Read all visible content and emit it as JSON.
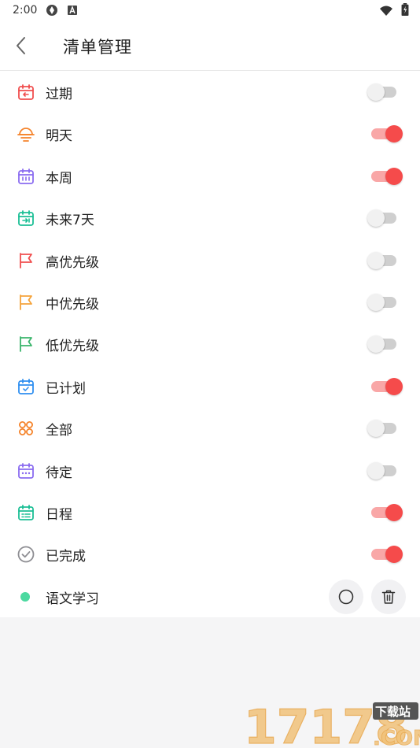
{
  "status_bar": {
    "time": "2:00"
  },
  "header": {
    "title": "清单管理"
  },
  "lists": [
    {
      "label": "过期",
      "icon": "calendar-overdue-icon",
      "color": "#f04e4e",
      "enabled": false
    },
    {
      "label": "明天",
      "icon": "sunrise-icon",
      "color": "#f5842c",
      "enabled": true
    },
    {
      "label": "本周",
      "icon": "calendar-week-icon",
      "color": "#8a6cf0",
      "enabled": true
    },
    {
      "label": "未来7天",
      "icon": "calendar-next7-icon",
      "color": "#1bbf95",
      "enabled": false
    },
    {
      "label": "高优先级",
      "icon": "flag-high-icon",
      "color": "#f04e4e",
      "enabled": false
    },
    {
      "label": "中优先级",
      "icon": "flag-medium-icon",
      "color": "#f5a33b",
      "enabled": false
    },
    {
      "label": "低优先级",
      "icon": "flag-low-icon",
      "color": "#3bb56c",
      "enabled": false
    },
    {
      "label": "已计划",
      "icon": "calendar-check-icon",
      "color": "#2f8ff0",
      "enabled": true
    },
    {
      "label": "全部",
      "icon": "all-circles-icon",
      "color": "#f5842c",
      "enabled": false
    },
    {
      "label": "待定",
      "icon": "calendar-pending-icon",
      "color": "#8a6cf0",
      "enabled": false
    },
    {
      "label": "日程",
      "icon": "calendar-schedule-icon",
      "color": "#1bbf95",
      "enabled": true
    },
    {
      "label": "已完成",
      "icon": "check-circle-icon",
      "color": "#8e8e93",
      "enabled": true
    }
  ],
  "custom_list": {
    "label": "语文学习",
    "dot_color": "#4cd9a0"
  },
  "colors": {
    "toggle_on": "#f54b4b",
    "toggle_on_track": "#f9a7a7",
    "toggle_off_track": "#cfcfcf"
  },
  "watermark": {
    "brand": "17178",
    "suffix": ".COM",
    "tag": "下载站"
  }
}
